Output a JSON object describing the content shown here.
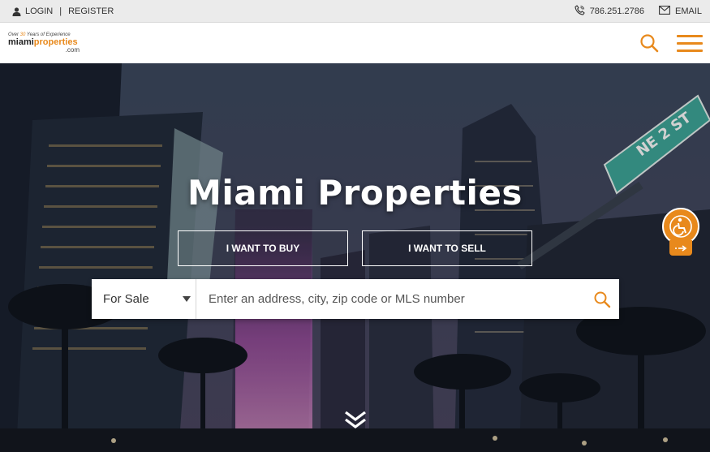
{
  "topbar": {
    "login_label": "LOGIN",
    "separator": "|",
    "register_label": "REGISTER",
    "phone": "786.251.2786",
    "email_label": "EMAIL",
    "icons": {
      "user": "user-icon",
      "phone": "phone-icon",
      "email": "envelope-icon"
    }
  },
  "header": {
    "logo": {
      "tagline_prefix": "Over ",
      "tagline_number": "30",
      "tagline_suffix": " Years of Experience",
      "word_part1": "miami",
      "word_part2": "properties",
      "domain": ".com"
    },
    "icons": {
      "search": "search-icon",
      "menu": "hamburger-menu-icon"
    }
  },
  "hero": {
    "title": "Miami Properties",
    "buy_label": "I WANT TO BUY",
    "sell_label": "I WANT TO SELL",
    "search": {
      "type_selected": "For Sale",
      "placeholder": "Enter an address, city, zip code or MLS number"
    },
    "street_sign": "NE 2 ST"
  },
  "colors": {
    "accent": "#e8891c",
    "topbar_bg": "#ebebeb",
    "text": "#333333"
  }
}
